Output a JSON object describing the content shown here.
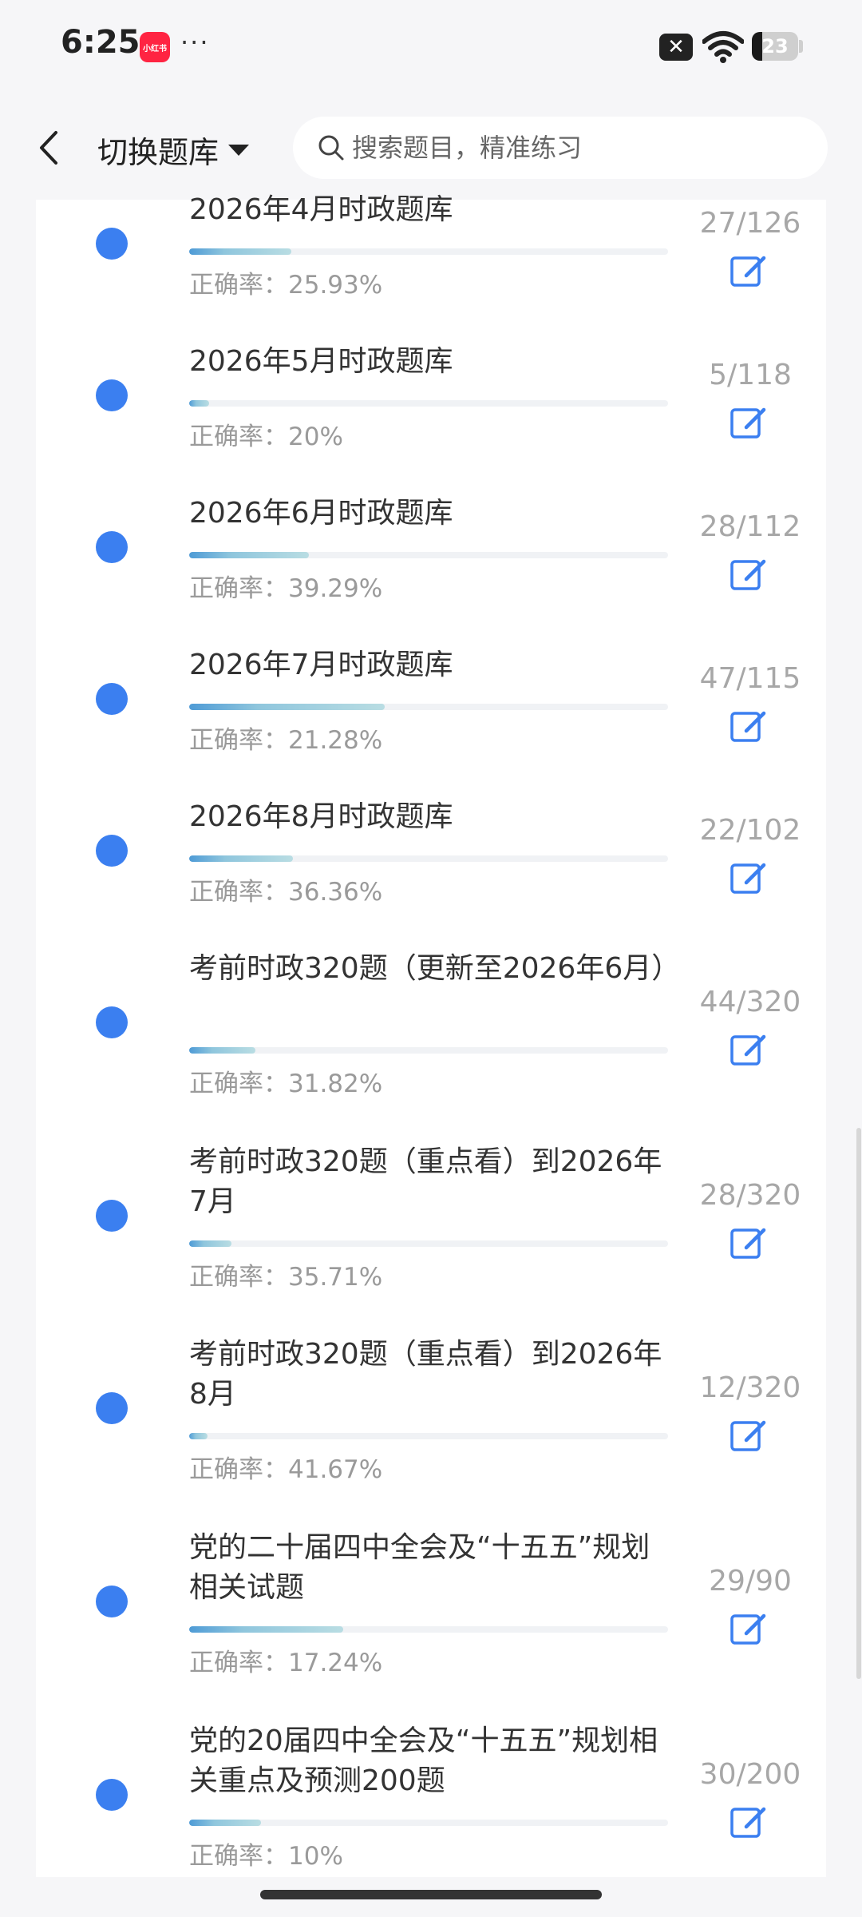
{
  "status_bar": {
    "time": "6:25",
    "app_icon_label": "小红书",
    "dots": "···",
    "battery": "23",
    "battery_level": 0.23
  },
  "header": {
    "back_icon": "chevron-left-icon",
    "switch_label": "切换题库",
    "search_placeholder": "搜索题目，精准练习"
  },
  "items": [
    {
      "title": "2026年4月时政题库",
      "accuracy": "正确率：25.93%",
      "count": "27/126",
      "progress": 0.214
    },
    {
      "title": "2026年5月时政题库",
      "accuracy": "正确率：20%",
      "count": "5/118",
      "progress": 0.042
    },
    {
      "title": "2026年6月时政题库",
      "accuracy": "正确率：39.29%",
      "count": "28/112",
      "progress": 0.25
    },
    {
      "title": "2026年7月时政题库",
      "accuracy": "正确率：21.28%",
      "count": "47/115",
      "progress": 0.409
    },
    {
      "title": "2026年8月时政题库",
      "accuracy": "正确率：36.36%",
      "count": "22/102",
      "progress": 0.216
    },
    {
      "title": "考前时政320题（更新至2026年6月）",
      "accuracy": "正确率：31.82%",
      "count": "44/320",
      "progress": 0.1375
    },
    {
      "title": "考前时政320题（重点看）到2026年7月",
      "accuracy": "正确率：35.71%",
      "count": "28/320",
      "progress": 0.0875
    },
    {
      "title": "考前时政320题（重点看）到2026年8月",
      "accuracy": "正确率：41.67%",
      "count": "12/320",
      "progress": 0.0375
    },
    {
      "title": "党的二十届四中全会及“十五五”规划相关试题",
      "accuracy": "正确率：17.24%",
      "count": "29/90",
      "progress": 0.322
    },
    {
      "title": "党的20届四中全会及“十五五”规划相关重点及预测200题",
      "accuracy": "正确率：10%",
      "count": "30/200",
      "progress": 0.15
    }
  ]
}
